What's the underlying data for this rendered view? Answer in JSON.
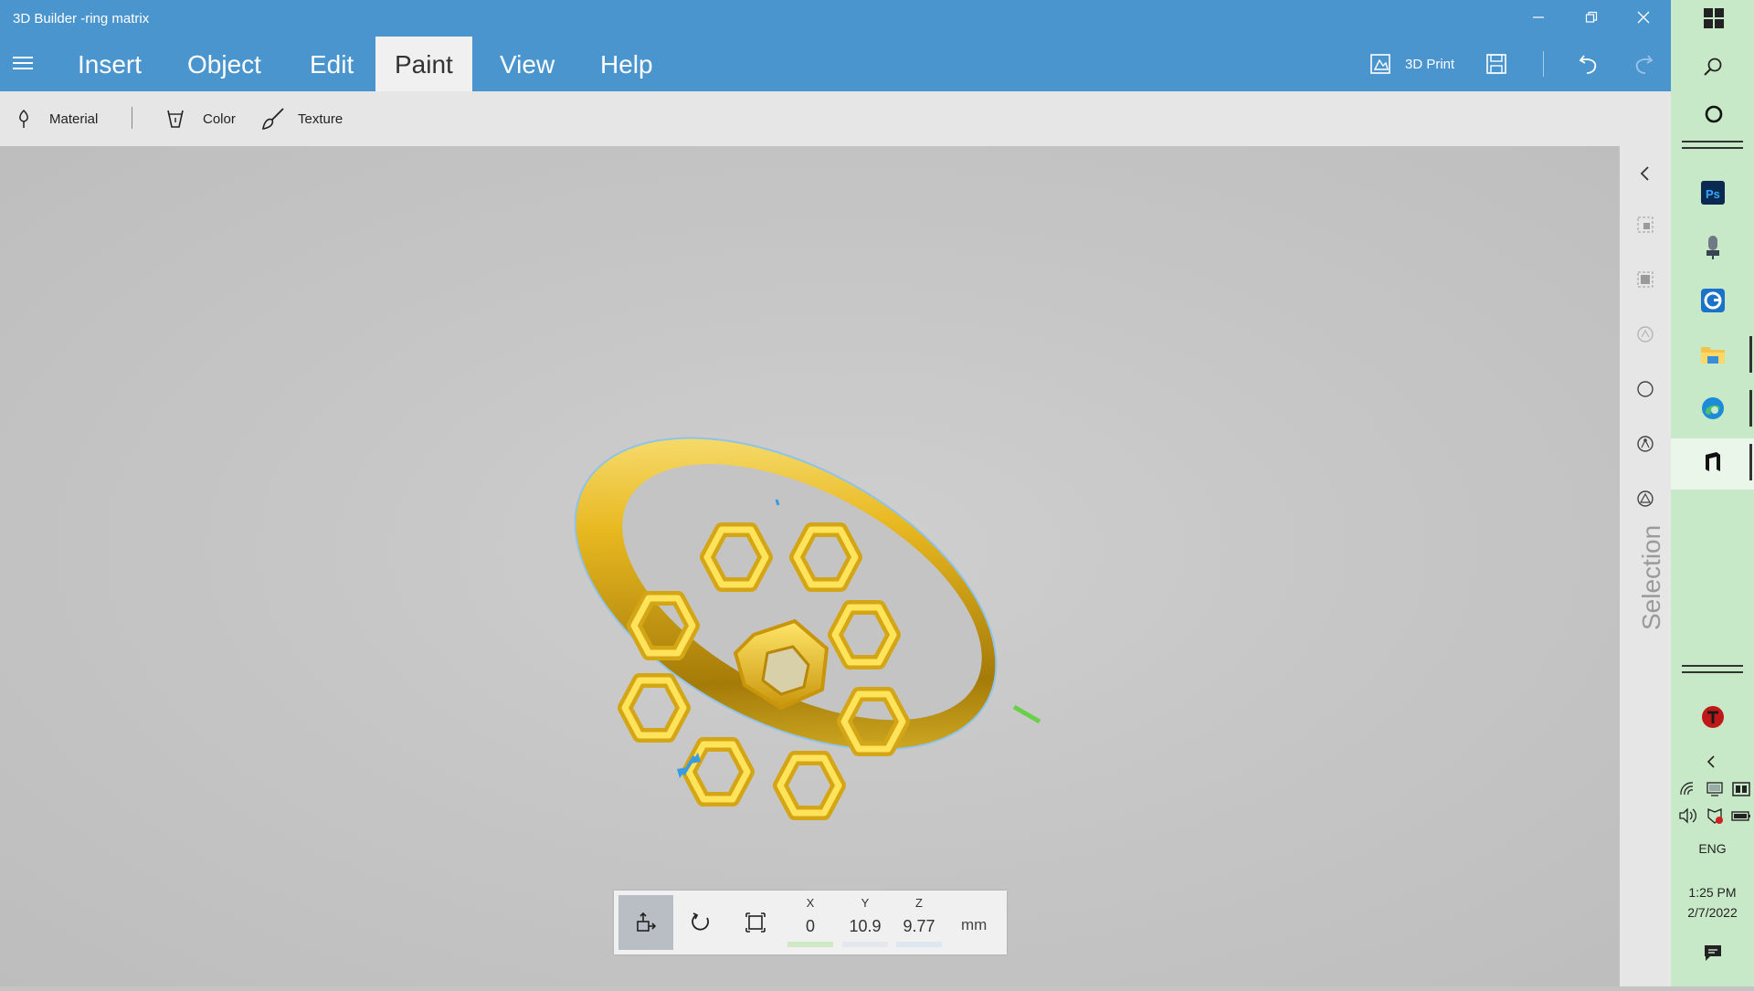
{
  "window": {
    "title": "3D Builder -ring matrix"
  },
  "menu": {
    "items": [
      {
        "label": "Insert",
        "active": false
      },
      {
        "label": "Object",
        "active": false
      },
      {
        "label": "Edit",
        "active": false
      },
      {
        "label": "Paint",
        "active": true
      },
      {
        "label": "View",
        "active": false
      },
      {
        "label": "Help",
        "active": false
      }
    ],
    "print_label": "3D Print"
  },
  "toolbar": {
    "material_label": "Material",
    "color_label": "Color",
    "texture_label": "Texture"
  },
  "side_panel": {
    "label": "Selection"
  },
  "position": {
    "x_label": "X",
    "x_value": "0",
    "y_label": "Y",
    "y_value": "10.9",
    "z_label": "Z",
    "z_value": "9.77",
    "unit": "mm"
  },
  "taskbar": {
    "language": "ENG",
    "time": "1:25 PM",
    "date": "2/7/2022",
    "pinned_apps": [
      "photoshop-icon",
      "microphone-app-icon",
      "grammarly-icon",
      "file-explorer-icon",
      "edge-icon",
      "3d-builder-icon"
    ]
  },
  "colors": {
    "accent": "#4b95cf",
    "ring_gold": "#e6b422",
    "taskbar": "#c8e9c8"
  }
}
